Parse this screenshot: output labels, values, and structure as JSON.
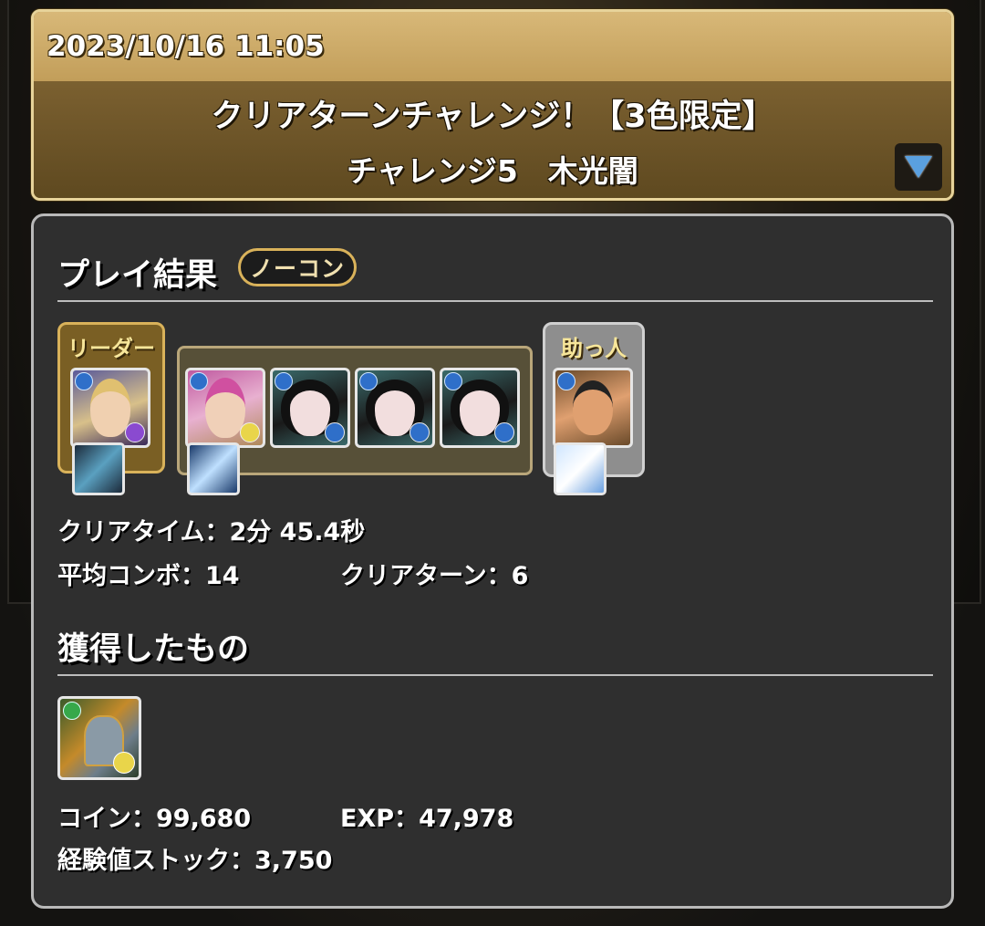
{
  "header": {
    "timestamp": "2023/10/16 11:05",
    "dungeon_title": "クリアターンチャレンジ！【3色限定】",
    "floor_title": "チャレンジ5　木光闇"
  },
  "results": {
    "section_title": "プレイ結果",
    "badge": "ノーコン",
    "leader_label": "リーダー",
    "helper_label": "助っ人",
    "clear_time_label": "クリアタイム：",
    "clear_time_value": "2分 45.4秒",
    "avg_combo_label": "平均コンボ：",
    "avg_combo_value": "14",
    "clear_turn_label": "クリアターン：",
    "clear_turn_value": "6"
  },
  "team": {
    "leader": {
      "icon": "blonde-character-icon",
      "attr_color": "#2f6fc9",
      "sub_attr_color": "#8a4ad0"
    },
    "subs": [
      {
        "icon": "pink-hair-character-icon",
        "attr_color": "#2f6fc9",
        "sub_attr_color": "#e9d54a"
      },
      {
        "icon": "black-hair-character-icon",
        "attr_color": "#2f6fc9",
        "sub_attr_color": "#2f6fc9"
      },
      {
        "icon": "black-hair-character-icon",
        "attr_color": "#2f6fc9",
        "sub_attr_color": "#2f6fc9"
      },
      {
        "icon": "black-hair-character-icon",
        "attr_color": "#2f6fc9",
        "sub_attr_color": "#2f6fc9"
      }
    ],
    "helper": {
      "icon": "fighter-character-icon",
      "attr_color": "#2f6fc9"
    }
  },
  "rewards": {
    "section_title": "獲得したもの",
    "drop_icon": "armored-knight-icon",
    "coin_label": "コイン：",
    "coin_value": "99,680",
    "exp_label": "EXP：",
    "exp_value": "47,978",
    "stock_label": "経験値ストック：",
    "stock_value": "3,750"
  }
}
